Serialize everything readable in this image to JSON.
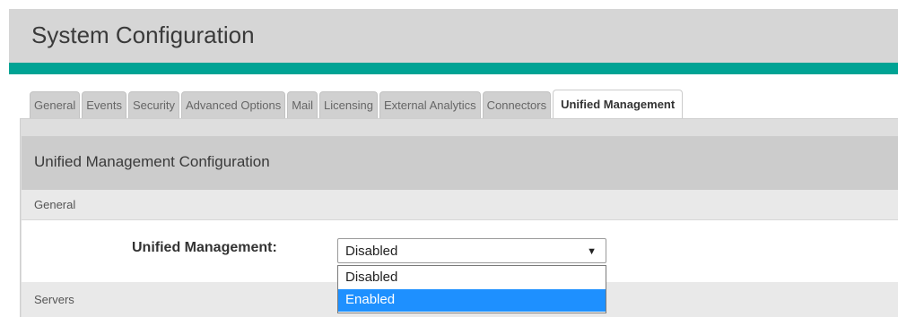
{
  "header": {
    "title": "System Configuration"
  },
  "tabs": [
    {
      "label": "General",
      "active": false
    },
    {
      "label": "Events",
      "active": false
    },
    {
      "label": "Security",
      "active": false
    },
    {
      "label": "Advanced Options",
      "active": false
    },
    {
      "label": "Mail",
      "active": false
    },
    {
      "label": "Licensing",
      "active": false
    },
    {
      "label": "External Analytics",
      "active": false
    },
    {
      "label": "Connectors",
      "active": false
    },
    {
      "label": "Unified Management",
      "active": true
    }
  ],
  "panel": {
    "title": "Unified Management Configuration",
    "sections": {
      "general": "General",
      "servers": "Servers"
    },
    "unified_management": {
      "label": "Unified Management:",
      "value": "Disabled",
      "options": [
        "Disabled",
        "Enabled"
      ],
      "highlighted_option": "Enabled"
    }
  },
  "colors": {
    "accent": "#00a394",
    "highlight": "#1e90ff"
  },
  "icons": {
    "dropdown_arrow": "triangle-down-icon"
  }
}
